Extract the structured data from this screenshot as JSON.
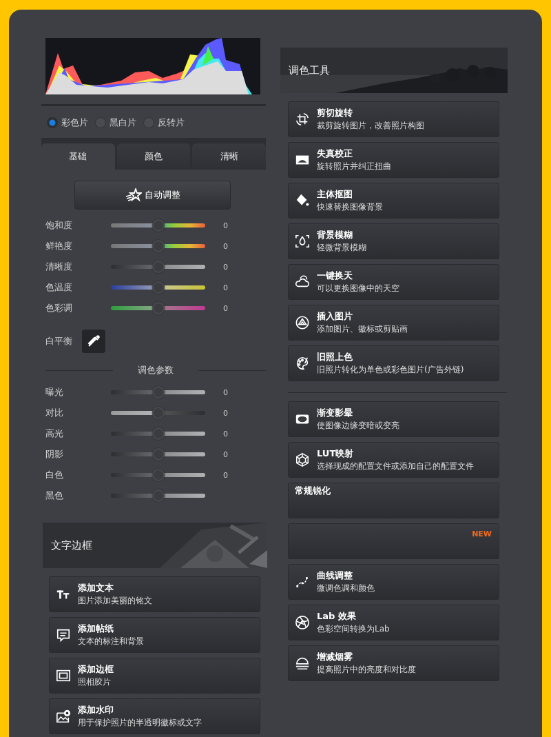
{
  "film_types": [
    {
      "label": "彩色片",
      "selected": true
    },
    {
      "label": "黑白片",
      "selected": false
    },
    {
      "label": "反转片",
      "selected": false
    }
  ],
  "tabs": [
    {
      "label": "基础",
      "selected": true
    },
    {
      "label": "颜色",
      "selected": false
    },
    {
      "label": "清晰",
      "selected": false
    }
  ],
  "auto_button": "自动调整",
  "basic_sliders": [
    {
      "label": "饱和度",
      "kind": "saturation",
      "level": 0.5,
      "reading": "0"
    },
    {
      "label": "鲜艳度",
      "kind": "saturation",
      "level": 0.5,
      "reading": "0"
    },
    {
      "label": "清晰度",
      "kind": "neutral",
      "level": 0.5,
      "reading": "0"
    },
    {
      "label": "色温度",
      "kind": "temperature",
      "level": 0.5,
      "reading": "0"
    },
    {
      "label": "色彩调",
      "kind": "tint",
      "level": 0.5,
      "reading": "0"
    }
  ],
  "white_balance": {
    "label": "白平衡"
  },
  "section_label": "调色参数",
  "tone_sliders": [
    {
      "label": "曝光",
      "kind": "neutral",
      "level": 0.5,
      "reading": "0"
    },
    {
      "label": "对比",
      "kind": "reverse",
      "level": 0.5,
      "reading": "0"
    },
    {
      "label": "高光",
      "kind": "neutral",
      "level": 0.5,
      "reading": "0"
    },
    {
      "label": "阴影",
      "kind": "neutral",
      "level": 0.5,
      "reading": "0"
    },
    {
      "label": "白色",
      "kind": "neutral",
      "level": 0.5,
      "reading": "0"
    },
    {
      "label": "黑色",
      "kind": "neutral",
      "level": 0.5
    }
  ],
  "text_section": {
    "title": "文字边框",
    "tools": [
      {
        "title": "添加文本",
        "description": "图片添加美丽的铭文"
      },
      {
        "title": "添加帖纸",
        "description": "文本的标注和背景"
      },
      {
        "title": "添加边框",
        "description": "照相胶片"
      },
      {
        "title": "添加水印",
        "description": "用于保护照片的半透明徽标或文字"
      }
    ]
  },
  "color_section": {
    "title": "调色工具",
    "tools": [
      {
        "title": "剪切旋转",
        "description": "裁剪旋转图片，改善照片构图"
      },
      {
        "title": "失真校正",
        "description": "旋转照片并纠正扭曲"
      },
      {
        "title": "主体抠图",
        "description": "快速替换图像背景"
      },
      {
        "title": "背景模糊",
        "description": "轻微背景模糊"
      },
      {
        "title": "一键换天",
        "description": "可以更换图像中的天空"
      },
      {
        "title": "插入图片",
        "description": "添加图片、徽标或剪贴画"
      },
      {
        "title": "旧照上色",
        "description": "旧照片转化为单色或彩色图片(广告外链)"
      }
    ],
    "more_tools": [
      {
        "title": "渐变影晕",
        "description": "使图像边缘变暗或变亮"
      },
      {
        "title": "LUT映射",
        "description": "选择现成的配置文件或添加自己的配置文件"
      },
      {
        "title": "常规锐化"
      },
      {
        "badge": "NEW"
      },
      {
        "title": "曲线调整",
        "description": "微调色调和颜色"
      },
      {
        "title": "Lab 效果",
        "description": "色彩空间转换为Lab"
      },
      {
        "title": "增减烟雾",
        "description": "提高照片中的亮度和对比度"
      }
    ]
  }
}
